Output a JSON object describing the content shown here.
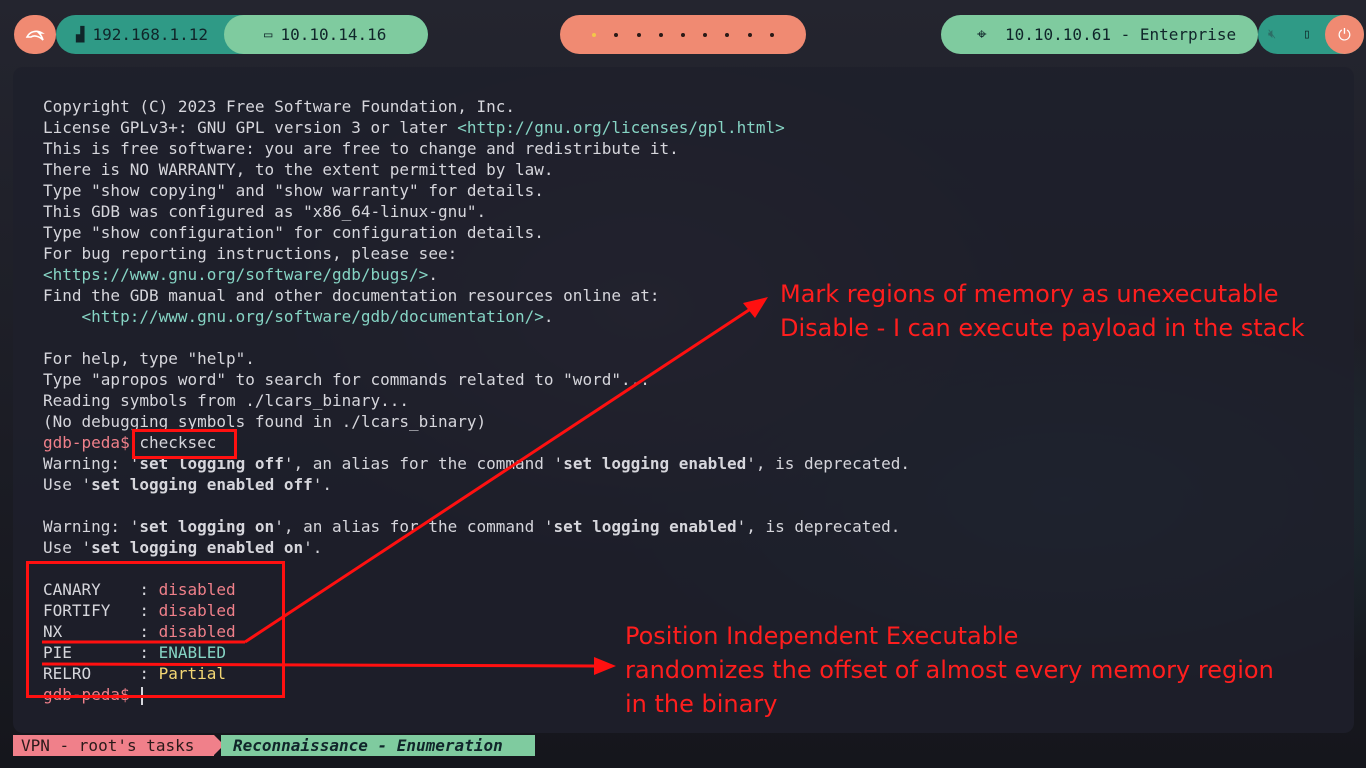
{
  "topbar": {
    "menu_icon": "kali-dragon-icon",
    "local_ip": "192.168.1.12",
    "vpn_ip": "10.10.14.16",
    "workspaces": [
      1,
      2,
      3,
      4,
      5,
      6,
      7,
      8,
      9
    ],
    "active_workspace_index": 0,
    "target": "10.10.10.61 - Enterprise",
    "icons": [
      "network-icon",
      "laptop-icon",
      "crosshair-icon",
      "mute-icon",
      "phone-icon",
      "power-icon"
    ]
  },
  "terminal": {
    "lines": [
      "Copyright (C) 2023 Free Software Foundation, Inc.",
      "License GPLv3+: GNU GPL version 3 or later ",
      "This is free software: you are free to change and redistribute it.",
      "There is NO WARRANTY, to the extent permitted by law.",
      "Type \"show copying\" and \"show warranty\" for details.",
      "This GDB was configured as \"x86_64-linux-gnu\".",
      "Type \"show configuration\" for configuration details.",
      "For bug reporting instructions, please see:",
      "",
      "Find the GDB manual and other documentation resources online at:",
      "    ",
      "",
      "For help, type \"help\".",
      "Type \"apropos word\" to search for commands related to \"word\"...",
      "Reading symbols from ./lcars_binary...",
      "(No debugging symbols found in ./lcars_binary)"
    ],
    "license_url": "<http://gnu.org/licenses/gpl.html>",
    "bugs_url": "<https://www.gnu.org/software/gdb/bugs/>",
    "bugs_suffix": ".",
    "doc_url": "<http://www.gnu.org/software/gdb/documentation/>",
    "doc_suffix": ".",
    "prompt": "gdb-peda$",
    "command": "checksec",
    "warn1": {
      "a": "Warning: '",
      "b": "set logging off",
      "c": "', an alias for the command '",
      "d": "set logging enabled",
      "e": "', is deprecated."
    },
    "use1": {
      "a": "Use '",
      "b": "set logging enabled off",
      "c": "'."
    },
    "warn2": {
      "a": "Warning: '",
      "b": "set logging on",
      "c": "', an alias for the command '",
      "d": "set logging enabled",
      "e": "', is deprecated."
    },
    "use2": {
      "a": "Use '",
      "b": "set logging enabled on",
      "c": "'."
    },
    "checksec": [
      {
        "name": "CANARY    : ",
        "value": "disabled",
        "color": "red"
      },
      {
        "name": "FORTIFY   : ",
        "value": "disabled",
        "color": "red"
      },
      {
        "name": "NX        : ",
        "value": "disabled",
        "color": "red"
      },
      {
        "name": "PIE       : ",
        "value": "ENABLED",
        "color": "green"
      },
      {
        "name": "RELRO     : ",
        "value": "Partial",
        "color": "yellow"
      }
    ]
  },
  "annotations": {
    "nx_note": "Mark regions of memory as unexecutable\nDisable - I can execute payload in the stack",
    "pie_note": "Position Independent Executable\nrandomizes the offset of almost every memory region\nin the binary",
    "color": "#ff1010"
  },
  "statusbar": {
    "session": "VPN - root's tasks",
    "window": "Reconnaissance - Enumeration"
  }
}
